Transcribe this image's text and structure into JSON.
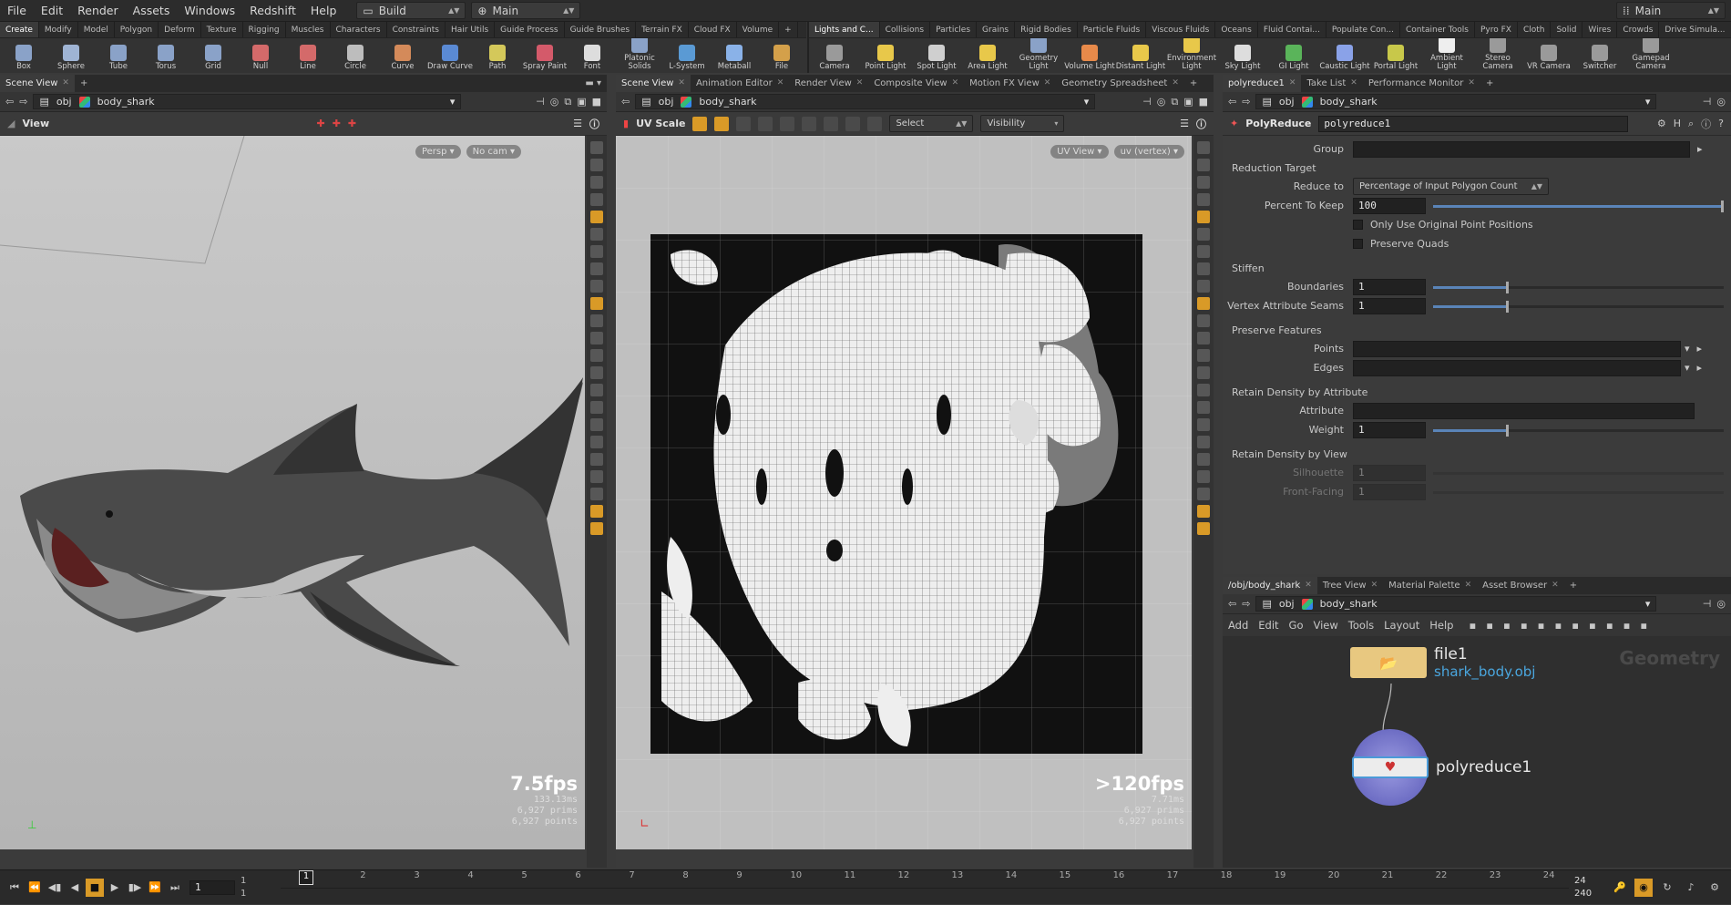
{
  "menubar": {
    "items": [
      "File",
      "Edit",
      "Render",
      "Assets",
      "Windows",
      "Redshift",
      "Help"
    ],
    "desktop": "Build",
    "context": "Main",
    "right_desktop": "Main"
  },
  "shelf": {
    "left_tabs": [
      "Create",
      "Modify",
      "Model",
      "Polygon",
      "Deform",
      "Texture",
      "Rigging",
      "Muscles",
      "Characters",
      "Constraints",
      "Hair Utils",
      "Guide Process",
      "Guide Brushes",
      "Terrain FX",
      "Cloud FX",
      "Volume"
    ],
    "right_tabs": [
      "Lights and C...",
      "Collisions",
      "Particles",
      "Grains",
      "Rigid Bodies",
      "Particle Fluids",
      "Viscous Fluids",
      "Oceans",
      "Fluid Contai...",
      "Populate Con...",
      "Container Tools",
      "Pyro FX",
      "Cloth",
      "Solid",
      "Wires",
      "Crowds",
      "Drive Simula..."
    ],
    "left_tools": [
      {
        "label": "Box",
        "icon": "box-icon",
        "color": "#8aa2c8"
      },
      {
        "label": "Sphere",
        "icon": "sphere-icon",
        "color": "#9fb4d4"
      },
      {
        "label": "Tube",
        "icon": "tube-icon",
        "color": "#8aa2c8"
      },
      {
        "label": "Torus",
        "icon": "torus-icon",
        "color": "#8aa2c8"
      },
      {
        "label": "Grid",
        "icon": "grid-icon",
        "color": "#8aa2c8"
      },
      {
        "label": "Null",
        "icon": "null-icon",
        "color": "#d46a6a"
      },
      {
        "label": "Line",
        "icon": "line-icon",
        "color": "#d46a6a"
      },
      {
        "label": "Circle",
        "icon": "circle-icon",
        "color": "#bdbdbd"
      },
      {
        "label": "Curve",
        "icon": "curve-icon",
        "color": "#d48a5a"
      },
      {
        "label": "Draw Curve",
        "icon": "draw-curve-icon",
        "color": "#5a8ad4"
      },
      {
        "label": "Path",
        "icon": "path-icon",
        "color": "#d4c85a"
      },
      {
        "label": "Spray Paint",
        "icon": "spray-paint-icon",
        "color": "#d45a6a"
      },
      {
        "label": "Font",
        "icon": "font-icon",
        "color": "#dddddd"
      },
      {
        "label": "Platonic Solids",
        "icon": "platonic-solids-icon",
        "color": "#8aa2c8"
      },
      {
        "label": "L-System",
        "icon": "l-system-icon",
        "color": "#5a9ad4"
      },
      {
        "label": "Metaball",
        "icon": "metaball-icon",
        "color": "#8ab2e8"
      },
      {
        "label": "File",
        "icon": "file-icon",
        "color": "#d4a04a"
      }
    ],
    "right_tools": [
      {
        "label": "Camera",
        "icon": "camera-icon",
        "color": "#9a9a9a"
      },
      {
        "label": "Point Light",
        "icon": "point-light-icon",
        "color": "#e8c84a"
      },
      {
        "label": "Spot Light",
        "icon": "spot-light-icon",
        "color": "#cfcfcf"
      },
      {
        "label": "Area Light",
        "icon": "area-light-icon",
        "color": "#e8c84a"
      },
      {
        "label": "Geometry Light",
        "icon": "geometry-light-icon",
        "color": "#8aa2c8"
      },
      {
        "label": "Volume Light",
        "icon": "volume-light-icon",
        "color": "#e88a4a"
      },
      {
        "label": "Distant Light",
        "icon": "distant-light-icon",
        "color": "#e8c84a"
      },
      {
        "label": "Environment Light",
        "icon": "environment-light-icon",
        "color": "#e8c84a"
      },
      {
        "label": "Sky Light",
        "icon": "sky-light-icon",
        "color": "#dddddd"
      },
      {
        "label": "GI Light",
        "icon": "gi-light-icon",
        "color": "#5ab45a"
      },
      {
        "label": "Caustic Light",
        "icon": "caustic-light-icon",
        "color": "#8aa2e8"
      },
      {
        "label": "Portal Light",
        "icon": "portal-light-icon",
        "color": "#c8c84a"
      },
      {
        "label": "Ambient Light",
        "icon": "ambient-light-icon",
        "color": "#eeeeee"
      },
      {
        "label": "Stereo Camera",
        "icon": "stereo-camera-icon",
        "color": "#9a9a9a"
      },
      {
        "label": "VR Camera",
        "icon": "vr-camera-icon",
        "color": "#9a9a9a"
      },
      {
        "label": "Switcher",
        "icon": "switcher-icon",
        "color": "#9a9a9a"
      },
      {
        "label": "Gamepad Camera",
        "icon": "gamepad-camera-icon",
        "color": "#9a9a9a"
      }
    ]
  },
  "left_pane": {
    "tab": "Scene View",
    "path_root": "obj",
    "path_node": "body_shark",
    "viewport_label": "View",
    "persp": "Persp",
    "cam": "No cam",
    "fps": "7.5fps",
    "ms": "133.13ms",
    "prims": "6,927  prims",
    "points": "6,927  points"
  },
  "mid_pane": {
    "tabs": [
      "Scene View",
      "Animation Editor",
      "Render View",
      "Composite View",
      "Motion FX View",
      "Geometry Spreadsheet"
    ],
    "path_root": "obj",
    "path_node": "body_shark",
    "tool_label": "UV Scale",
    "select_label": "Select",
    "visibility_label": "Visibility",
    "uv_view": "UV View",
    "uv_attr": "uv (vertex)",
    "fps": ">120fps",
    "ms": "7.71ms",
    "prims": "6,927  prims",
    "points": "6,927  points"
  },
  "params": {
    "tabs": [
      "polyreduce1",
      "Take List",
      "Performance Monitor"
    ],
    "path_root": "obj",
    "path_node": "body_shark",
    "node_type": "PolyReduce",
    "node_name": "polyreduce1",
    "group_label": "Group",
    "reduction_target": "Reduction Target",
    "reduce_to_label": "Reduce to",
    "reduce_to_value": "Percentage of Input Polygon Count",
    "percent_label": "Percent To Keep",
    "percent_value": "100",
    "percent_fraction": 1.0,
    "only_original": "Only Use Original Point Positions",
    "preserve_quads": "Preserve Quads",
    "stiffen": "Stiffen",
    "boundaries_label": "Boundaries",
    "boundaries_value": "1",
    "seams_label": "Vertex Attribute Seams",
    "seams_value": "1",
    "preserve_features": "Preserve Features",
    "points_label": "Points",
    "edges_label": "Edges",
    "retain_attr": "Retain Density by Attribute",
    "attribute_label": "Attribute",
    "weight_label": "Weight",
    "weight_value": "1",
    "retain_view": "Retain Density by View",
    "silhouette_label": "Silhouette",
    "silhouette_value": "1",
    "frontfacing_label": "Front-Facing",
    "frontfacing_value": "1"
  },
  "network": {
    "tabs": [
      "/obj/body_shark",
      "Tree View",
      "Material Palette",
      "Asset Browser"
    ],
    "path_root": "obj",
    "path_node": "body_shark",
    "menu": [
      "Add",
      "Edit",
      "Go",
      "View",
      "Tools",
      "Layout",
      "Help"
    ],
    "context_label": "Geometry",
    "node1_name": "file1",
    "node1_file": "shark_body.obj",
    "node2_name": "polyreduce1"
  },
  "timeline": {
    "start": "1",
    "end": "1",
    "current": "1",
    "ticks": [
      "1",
      "2",
      "3",
      "4",
      "5",
      "6",
      "7",
      "8",
      "9",
      "10",
      "11",
      "12",
      "13",
      "14",
      "15",
      "16",
      "17",
      "18",
      "19",
      "20",
      "21",
      "22",
      "23",
      "24"
    ],
    "range_end": "24",
    "range_end2": "240"
  }
}
